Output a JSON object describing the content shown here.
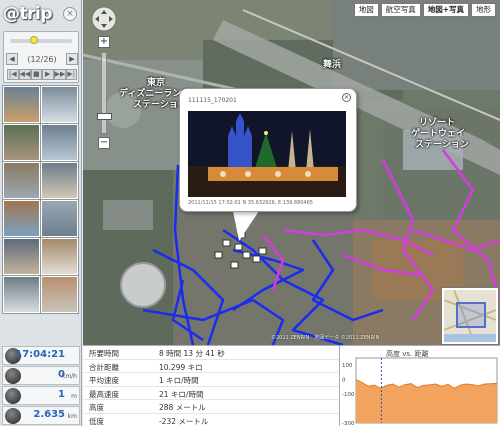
{
  "app": {
    "logo_text": "@trip",
    "logo_close": "×"
  },
  "player": {
    "counter": "(12/26)",
    "prev_label": "◀",
    "next_label": "▶",
    "controls": [
      "|◀",
      "◀◀",
      "■",
      "▶",
      "▶▶",
      "▶|"
    ],
    "progress": 0.38
  },
  "thumbnails": {
    "colors": [
      [
        "#6b8096",
        "#c9a06a"
      ],
      [
        "#7a8d9c",
        "#d7dde3"
      ],
      [
        "#5d6f54",
        "#a7967d"
      ],
      [
        "#6d7f91",
        "#b9c7d1"
      ],
      [
        "#8a7a62",
        "#9ba8b1"
      ],
      [
        "#6e7d8c",
        "#d2c7b4"
      ],
      [
        "#a07650",
        "#7ba1c0"
      ],
      [
        "#9aa7b2",
        "#6b7f8f"
      ],
      [
        "#5f6a7a",
        "#c2b49c"
      ],
      [
        "#a38a6c",
        "#e3ddd3"
      ],
      [
        "#6f7c85",
        "#d6dde2"
      ],
      [
        "#b99070",
        "#c9c3bb"
      ]
    ]
  },
  "stats_left": {
    "time": {
      "value": "17:04:21",
      "unit": ""
    },
    "speed": {
      "value": "0",
      "unit": "km/h"
    },
    "altitude": {
      "value": "1",
      "unit": "m"
    },
    "distance": {
      "value": "2.635",
      "unit": "km"
    }
  },
  "map": {
    "types": [
      "地図",
      "航空写真",
      "地図+写真",
      "地形"
    ],
    "active_type": 2,
    "zoom_plus": "+",
    "zoom_minus": "−",
    "labels": {
      "station1": "東京",
      "station2": "ディズニーランド",
      "station3": "ステーション",
      "maihama": "舞浜",
      "resort": "リゾート",
      "gateway": "ゲートウェイ",
      "station4": "ステーション"
    },
    "copyright": "©2011 ZENRIN - 地図データ ©2011 ZENRIN"
  },
  "popup": {
    "title": "111115_170201",
    "close": "×",
    "caption": "2011/11/15 17:02:01 N 35.632926, E 139.880465"
  },
  "info": {
    "rows": [
      {
        "label": "所要時間",
        "value": "8 時間 13 分 41 秒"
      },
      {
        "label": "合計距離",
        "value": "10.299 キロ"
      },
      {
        "label": "平均速度",
        "value": "1 キロ/時間"
      },
      {
        "label": "最高速度",
        "value": "21 キロ/時間"
      },
      {
        "label": "高度",
        "value": "288 メートル"
      },
      {
        "label": "低度",
        "value": "-232 メートル"
      }
    ]
  },
  "elevation": {
    "title": "高度 vs. 距離",
    "ylabels": [
      "100",
      "0",
      "-100",
      "-300"
    ],
    "values": [
      0,
      -20,
      -45,
      -38,
      -60,
      -40,
      -30,
      -52,
      -34,
      -28,
      -55,
      -40,
      -36,
      -30,
      -46,
      -32,
      -60,
      -38,
      -30,
      -35,
      -42,
      -30,
      -28,
      -26
    ],
    "ylim": [
      -300,
      150
    ],
    "marker_fraction": 0.18,
    "fill_color": "#f2a35e",
    "line_color": "#e07a2a"
  },
  "colors": {
    "track_blue": "#1a2cf0",
    "track_magenta": "#d43be0",
    "accent_value": "#2a64b8"
  }
}
